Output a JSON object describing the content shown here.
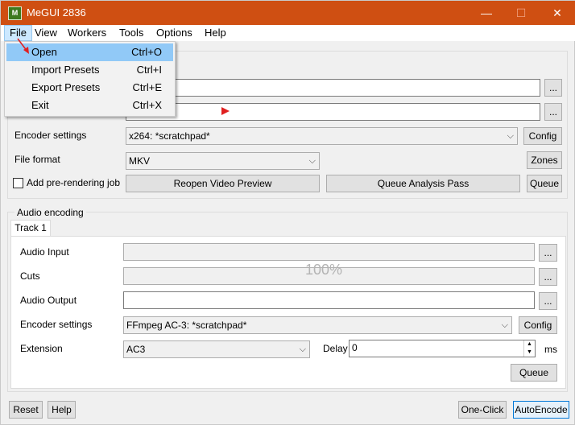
{
  "window": {
    "title": "MeGUI 2836",
    "icon_text": "M",
    "minimize": "—",
    "maximize": "☐",
    "close": "✕"
  },
  "menu": [
    "File",
    "View",
    "Workers",
    "Tools",
    "Options",
    "Help"
  ],
  "file_menu": [
    {
      "label": "Open",
      "shortcut": "Ctrl+O"
    },
    {
      "label": "Import Presets",
      "shortcut": "Ctrl+I"
    },
    {
      "label": "Export Presets",
      "shortcut": "Ctrl+E"
    },
    {
      "label": "Exit",
      "shortcut": "Ctrl+X"
    }
  ],
  "video": {
    "browse": "...",
    "encoder_label": "Encoder settings",
    "encoder_value": "x264: *scratchpad*",
    "config": "Config",
    "format_label": "File format",
    "format_value": "MKV",
    "zones": "Zones",
    "prerender_label": "Add pre-rendering job",
    "reopen_preview": "Reopen Video Preview",
    "queue_analysis": "Queue Analysis Pass",
    "queue": "Queue"
  },
  "audio": {
    "group_label": "Audio encoding",
    "tab": "Track 1",
    "input_label": "Audio Input",
    "cuts_label": "Cuts",
    "output_label": "Audio Output",
    "encoder_label": "Encoder settings",
    "encoder_value": "FFmpeg AC-3: *scratchpad*",
    "config": "Config",
    "extension_label": "Extension",
    "extension_value": "AC3",
    "delay_label": "Delay",
    "delay_value": "0",
    "delay_unit": "ms",
    "queue": "Queue",
    "browse": "...",
    "progress_overlay": "100%"
  },
  "bottom": {
    "reset": "Reset",
    "help": "Help",
    "one_click": "One-Click",
    "auto_encode": "AutoEncode"
  }
}
